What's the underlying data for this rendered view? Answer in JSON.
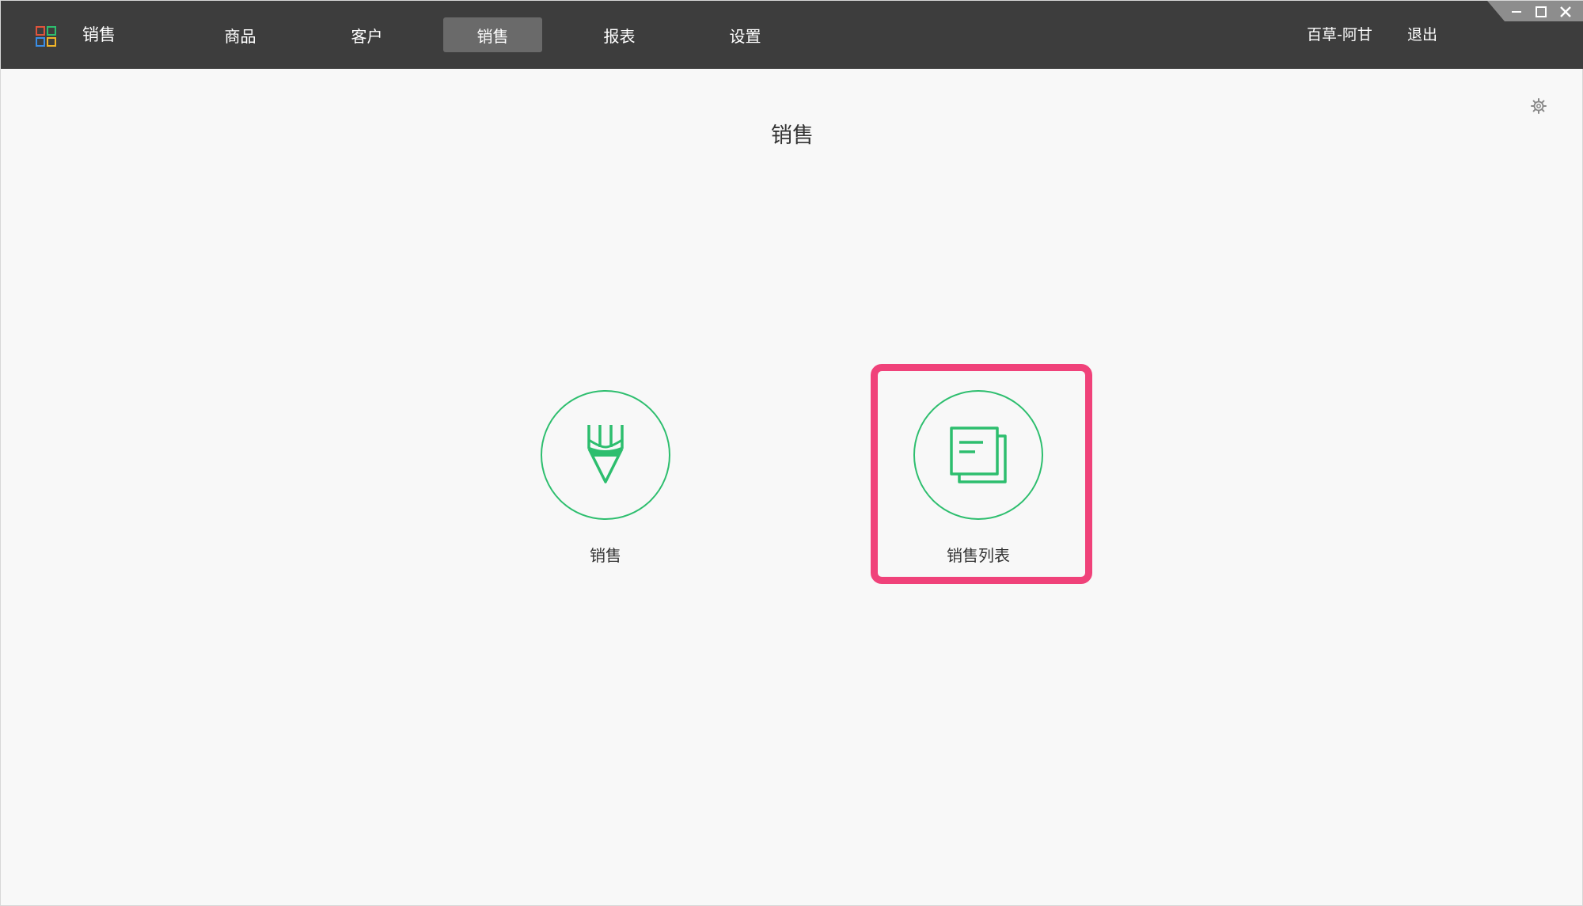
{
  "app": {
    "title": "销售"
  },
  "nav": {
    "tabs": [
      {
        "label": "商品"
      },
      {
        "label": "客户"
      },
      {
        "label": "销售",
        "active": true
      },
      {
        "label": "报表"
      },
      {
        "label": "设置"
      }
    ]
  },
  "user": {
    "name": "百草-阿甘",
    "logout_label": "退出"
  },
  "main": {
    "title": "销售",
    "tiles": [
      {
        "label": "销售",
        "icon": "pencil-icon"
      },
      {
        "label": "销售列表",
        "icon": "document-list-icon",
        "highlighted": true
      }
    ]
  },
  "colors": {
    "topbar": "#3d3d3d",
    "active_tab": "#6a6a6a",
    "accent_green": "#2dbe6e",
    "highlight_pink": "#f0427a",
    "background": "#f8f8f8"
  }
}
